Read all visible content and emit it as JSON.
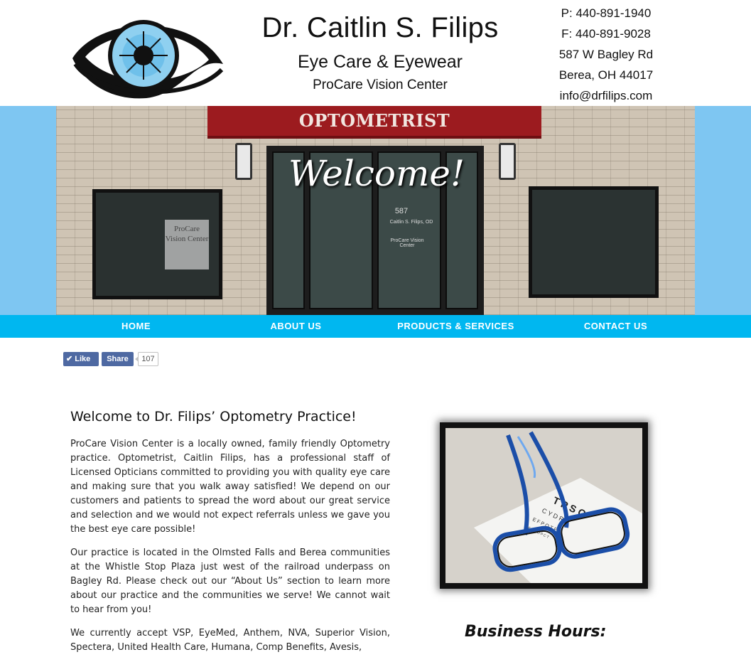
{
  "header": {
    "title": "Dr. Caitlin S. Filips",
    "subtitle": "Eye Care & Eyewear",
    "tagline": "ProCare Vision Center",
    "contact": {
      "phone": "P: 440-891-1940",
      "fax": "F: 440-891-9028",
      "street": "587 W Bagley Rd",
      "city": "Berea, OH 44017",
      "email": "info@drfilips.com"
    }
  },
  "hero": {
    "sign": "OPTOMETRIST",
    "welcome": "Welcome!",
    "door_number": "587",
    "door_name": "Caitlin S. Filips, OD",
    "door_center": "ProCare Vision Center",
    "window_text": "ProCare Vision Center"
  },
  "nav": {
    "items": [
      {
        "label": "HOME"
      },
      {
        "label": "ABOUT US"
      },
      {
        "label": "PRODUCTS & SERVICES"
      },
      {
        "label": "CONTACT US"
      }
    ]
  },
  "social": {
    "like_label": "Like",
    "share_label": "Share",
    "count": "107"
  },
  "main": {
    "heading": "Welcome to Dr. Filips’ Optometry Practice!",
    "paragraphs": [
      "ProCare Vision Center is a locally owned, family friendly Optometry practice. Optometrist, Caitlin Filips, has a professional staff of Licensed Opticians committed to providing you with quality eye care and making sure that you walk away satisfied! We depend on our customers and patients to spread the word about our great service and selection and we would not expect referrals unless we gave you the best eye care possible!",
      "Our practice is located in the Olmsted Falls and Berea communities at the Whistle Stop Plaza just west of the railroad underpass on Bagley Rd. Please check out our “About Us” section to learn more about our practice and the communities we serve! We cannot wait to hear from you!",
      "We currently accept VSP, EyeMed, Anthem, NVA, Superior Vision, Spectera, United Health Care, Humana, Comp Benefits, Avesis,"
    ]
  },
  "sidebar": {
    "hours_heading": "Business Hours:",
    "chart_letters": "T P S O"
  },
  "colors": {
    "nav_bg": "#00b7f0",
    "hero_band": "#7ec6f2",
    "awning": "#9c1b1f",
    "facebook": "#4e69a2"
  }
}
